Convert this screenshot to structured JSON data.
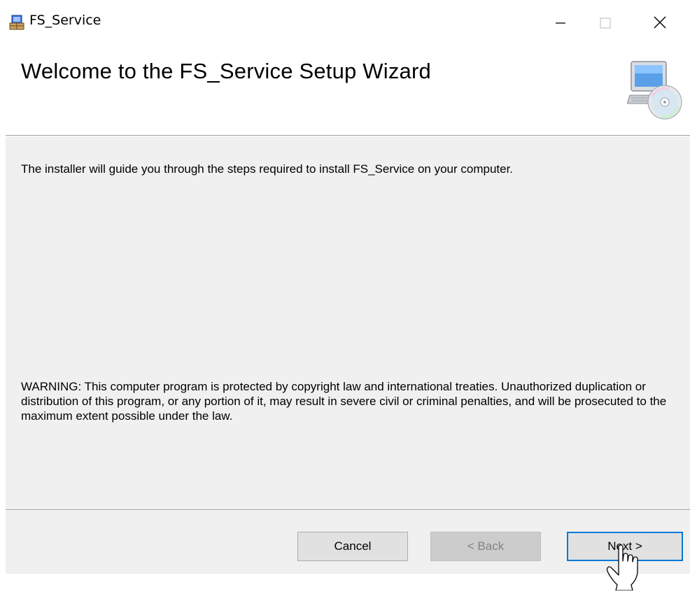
{
  "window": {
    "title": "FS_Service",
    "controls": {
      "minimize": "—",
      "maximize": "☐",
      "close": "✕"
    }
  },
  "header": {
    "title": "Welcome to the FS_Service Setup Wizard",
    "icon": "computer-cd-icon"
  },
  "content": {
    "intro": "The installer will guide you through the steps required to install FS_Service on your computer.",
    "warning": "WARNING: This computer program is protected by copyright law and international treaties. Unauthorized duplication or distribution of this program, or any portion of it, may result in severe civil or criminal penalties, and will be prosecuted to the maximum extent possible under the law."
  },
  "footer": {
    "cancel_label": "Cancel",
    "back_label": "< Back",
    "next_label": "Next >"
  },
  "colors": {
    "panel_background": "#f0f0f0",
    "focus_border": "#0078d7"
  }
}
